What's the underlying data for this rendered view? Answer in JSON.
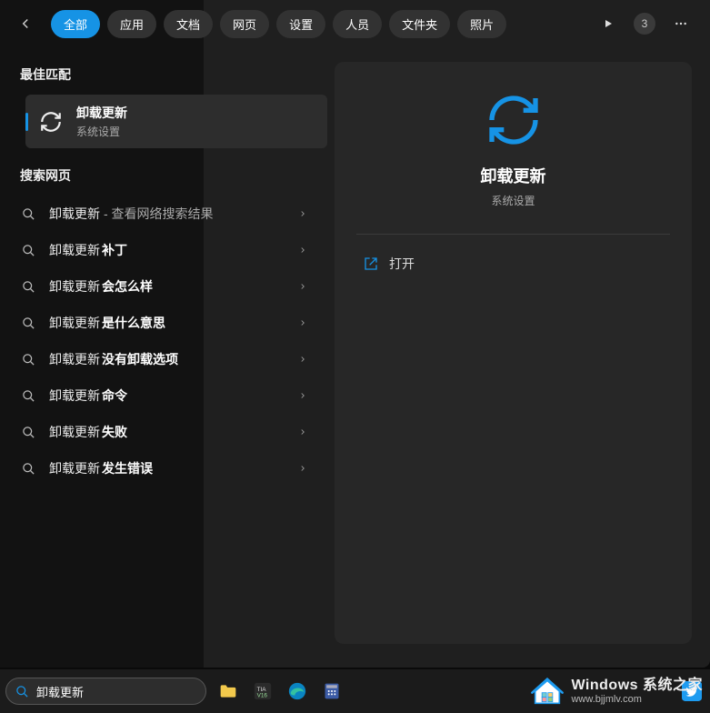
{
  "tabs": {
    "items": [
      {
        "label": "全部",
        "active": true
      },
      {
        "label": "应用",
        "active": false
      },
      {
        "label": "文档",
        "active": false
      },
      {
        "label": "网页",
        "active": false
      },
      {
        "label": "设置",
        "active": false
      },
      {
        "label": "人员",
        "active": false
      },
      {
        "label": "文件夹",
        "active": false
      },
      {
        "label": "照片",
        "active": false
      }
    ],
    "count_badge": "3"
  },
  "best_match": {
    "section_title": "最佳匹配",
    "title": "卸载更新",
    "subtitle": "系统设置"
  },
  "web": {
    "section_title": "搜索网页",
    "items": [
      {
        "prefix": "卸载更新",
        "bold": "",
        "hint": " - 查看网络搜索结果"
      },
      {
        "prefix": "卸载更新",
        "bold": "补丁",
        "hint": ""
      },
      {
        "prefix": "卸载更新",
        "bold": "会怎么样",
        "hint": ""
      },
      {
        "prefix": "卸载更新",
        "bold": "是什么意思",
        "hint": ""
      },
      {
        "prefix": "卸载更新",
        "bold": "没有卸载选项",
        "hint": ""
      },
      {
        "prefix": "卸载更新",
        "bold": "命令",
        "hint": ""
      },
      {
        "prefix": "卸载更新",
        "bold": "失败",
        "hint": ""
      },
      {
        "prefix": "卸载更新",
        "bold": "发生错误",
        "hint": ""
      }
    ]
  },
  "detail": {
    "title": "卸载更新",
    "subtitle": "系统设置",
    "action_open": "打开"
  },
  "taskbar": {
    "search_value": "卸载更新"
  },
  "watermark": {
    "line1": "Windows 系统之家",
    "line2": "www.bjjmlv.com"
  },
  "colors": {
    "accent": "#1693e5"
  }
}
